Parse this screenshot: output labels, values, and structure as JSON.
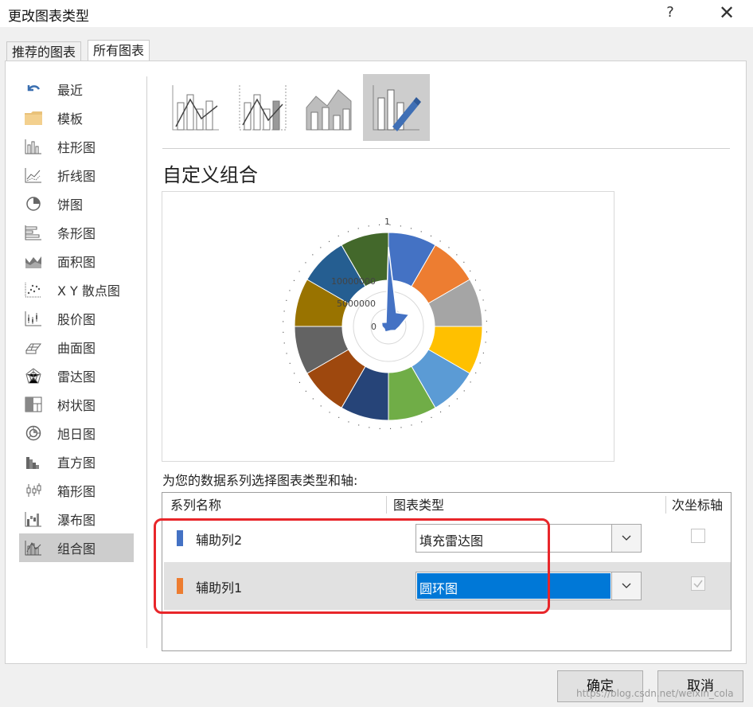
{
  "dialog": {
    "title": "更改图表类型",
    "help": "?",
    "close": "✕"
  },
  "tabs": [
    {
      "label": "推荐的图表"
    },
    {
      "label": "所有图表"
    }
  ],
  "sidebar": {
    "items": [
      {
        "label": "最近",
        "icon": "undo-arrow-icon"
      },
      {
        "label": "模板",
        "icon": "folder-icon"
      },
      {
        "label": "柱形图",
        "icon": "column-chart-icon"
      },
      {
        "label": "折线图",
        "icon": "line-chart-icon"
      },
      {
        "label": "饼图",
        "icon": "pie-chart-icon"
      },
      {
        "label": "条形图",
        "icon": "bar-chart-icon"
      },
      {
        "label": "面积图",
        "icon": "area-chart-icon"
      },
      {
        "label": "X Y 散点图",
        "icon": "scatter-chart-icon"
      },
      {
        "label": "股价图",
        "icon": "stock-chart-icon"
      },
      {
        "label": "曲面图",
        "icon": "surface-chart-icon"
      },
      {
        "label": "雷达图",
        "icon": "radar-chart-icon"
      },
      {
        "label": "树状图",
        "icon": "treemap-chart-icon"
      },
      {
        "label": "旭日图",
        "icon": "sunburst-chart-icon"
      },
      {
        "label": "直方图",
        "icon": "histogram-chart-icon"
      },
      {
        "label": "箱形图",
        "icon": "box-whisker-chart-icon"
      },
      {
        "label": "瀑布图",
        "icon": "waterfall-chart-icon"
      },
      {
        "label": "组合图",
        "icon": "combo-chart-icon",
        "active": true
      }
    ]
  },
  "section": {
    "title": "自定义组合"
  },
  "preview": {
    "labels": {
      "zero": "0",
      "mid": "5000000",
      "high": "10000000",
      "top": "1"
    }
  },
  "series_table": {
    "instruction": "为您的数据系列选择图表类型和轴:",
    "headers": {
      "name": "系列名称",
      "type": "图表类型",
      "secondary": "次坐标轴"
    },
    "rows": [
      {
        "name": "辅助列2",
        "color": "#4472c4",
        "type": "填充雷达图",
        "secondary": false
      },
      {
        "name": "辅助列1",
        "color": "#ed7d31",
        "type": "圆环图",
        "secondary": true
      }
    ]
  },
  "buttons": {
    "ok": "确定",
    "cancel": "取消"
  },
  "watermark": "https://blog.csdn.net/weixin_cola"
}
